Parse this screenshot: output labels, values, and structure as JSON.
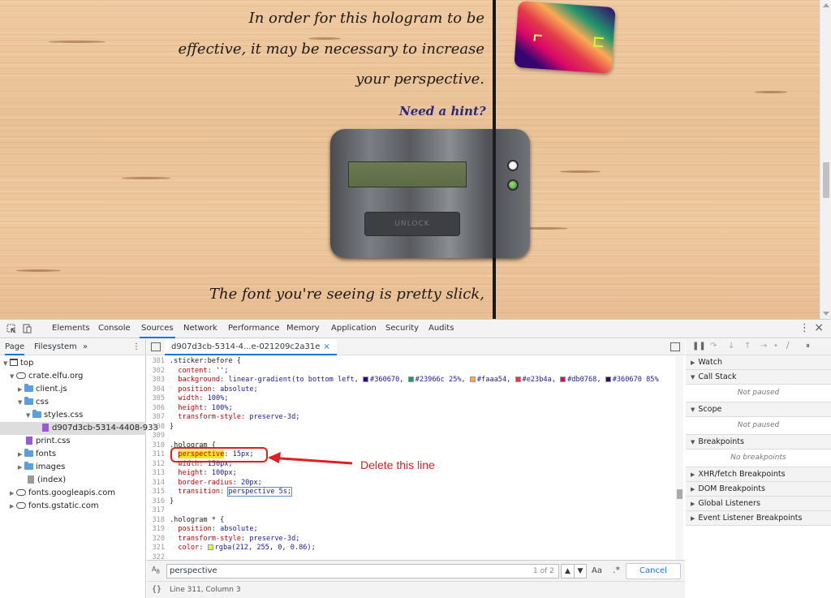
{
  "website": {
    "text_lines": [
      "In order for this hologram to be",
      "effective, it may be necessary to increase",
      "your perspective.",
      "The font you're seeing is pretty slick,"
    ],
    "hint_link": "Need a hint?",
    "unlock_label": "UNLOCK"
  },
  "devtools": {
    "tabs": [
      "Elements",
      "Console",
      "Sources",
      "Network",
      "Performance",
      "Memory",
      "Application",
      "Security",
      "Audits"
    ],
    "active_tab": "Sources",
    "navigator": {
      "tabs": [
        "Page",
        "Filesystem"
      ],
      "more": "»",
      "tree": [
        "top",
        "crate.elfu.org",
        "client.js",
        "css",
        "styles.css",
        "d907d3cb-5314-4408-933",
        "print.css",
        "fonts",
        "images",
        "(index)",
        "fonts.googleapis.com",
        "fonts.gstatic.com"
      ]
    },
    "editor": {
      "file_tab": "d907d3cb-5314-4...e-021209c2a31e",
      "close": "×",
      "lines": [
        {
          "n": "301",
          "t": ".sticker:before {"
        },
        {
          "n": "302",
          "p": "content",
          "v": "'';"
        },
        {
          "n": "303",
          "p": "background",
          "v": "linear-gradient(to bottom left,"
        },
        {
          "n": "304",
          "p": "position",
          "v": "absolute;"
        },
        {
          "n": "305",
          "p": "width",
          "v": "100%;"
        },
        {
          "n": "306",
          "p": "height",
          "v": "100%;"
        },
        {
          "n": "307",
          "p": "transform-style",
          "v": "preserve-3d;"
        },
        {
          "n": "308",
          "t": "}"
        },
        {
          "n": "309",
          "t": ""
        },
        {
          "n": "310",
          "t": ".hologram {"
        },
        {
          "n": "311",
          "p": "perspective",
          "v": "15px;"
        },
        {
          "n": "312",
          "p": "width",
          "v": "150px;"
        },
        {
          "n": "313",
          "p": "height",
          "v": "100px;"
        },
        {
          "n": "314",
          "p": "border-radius",
          "v": "20px;"
        },
        {
          "n": "315",
          "p": "transition",
          "v": "perspective 5s;"
        },
        {
          "n": "316",
          "t": "}"
        },
        {
          "n": "317",
          "t": ""
        },
        {
          "n": "318",
          "t": ".hologram * {"
        },
        {
          "n": "319",
          "p": "position",
          "v": "absolute;"
        },
        {
          "n": "320",
          "p": "transform-style",
          "v": "preserve-3d;"
        },
        {
          "n": "321",
          "p": "color",
          "v": "rgba(212, 255, 0, 0.86);"
        },
        {
          "n": "322",
          "t": ""
        }
      ],
      "gradient_stops": [
        {
          "color": "#360670",
          "label": "#360670,"
        },
        {
          "color": "#23966c",
          "label": "#23966c 25%,"
        },
        {
          "color": "#faaa54",
          "label": "#faaa54,"
        },
        {
          "color": "#e23b4a",
          "label": "#e23b4a,"
        },
        {
          "color": "#db0768",
          "label": "#db0768,"
        },
        {
          "color": "#360670",
          "label": "#360670 85%"
        }
      ],
      "search": {
        "value": "perspective",
        "count": "1 of 2",
        "case_label": "Aa",
        "regex_label": ".*",
        "cancel": "Cancel",
        "up": "▲",
        "down": "▼"
      },
      "status": {
        "braces": "{}",
        "position": "Line 311, Column 3"
      }
    },
    "debugger": {
      "sections": [
        "Watch",
        "Call Stack",
        "Scope",
        "Breakpoints",
        "XHR/fetch Breakpoints",
        "DOM Breakpoints",
        "Global Listeners",
        "Event Listener Breakpoints"
      ],
      "not_paused": "Not paused",
      "no_breakpoints": "No breakpoints"
    }
  },
  "annotation": {
    "text": "Delete this line",
    "color": "#e02020"
  }
}
